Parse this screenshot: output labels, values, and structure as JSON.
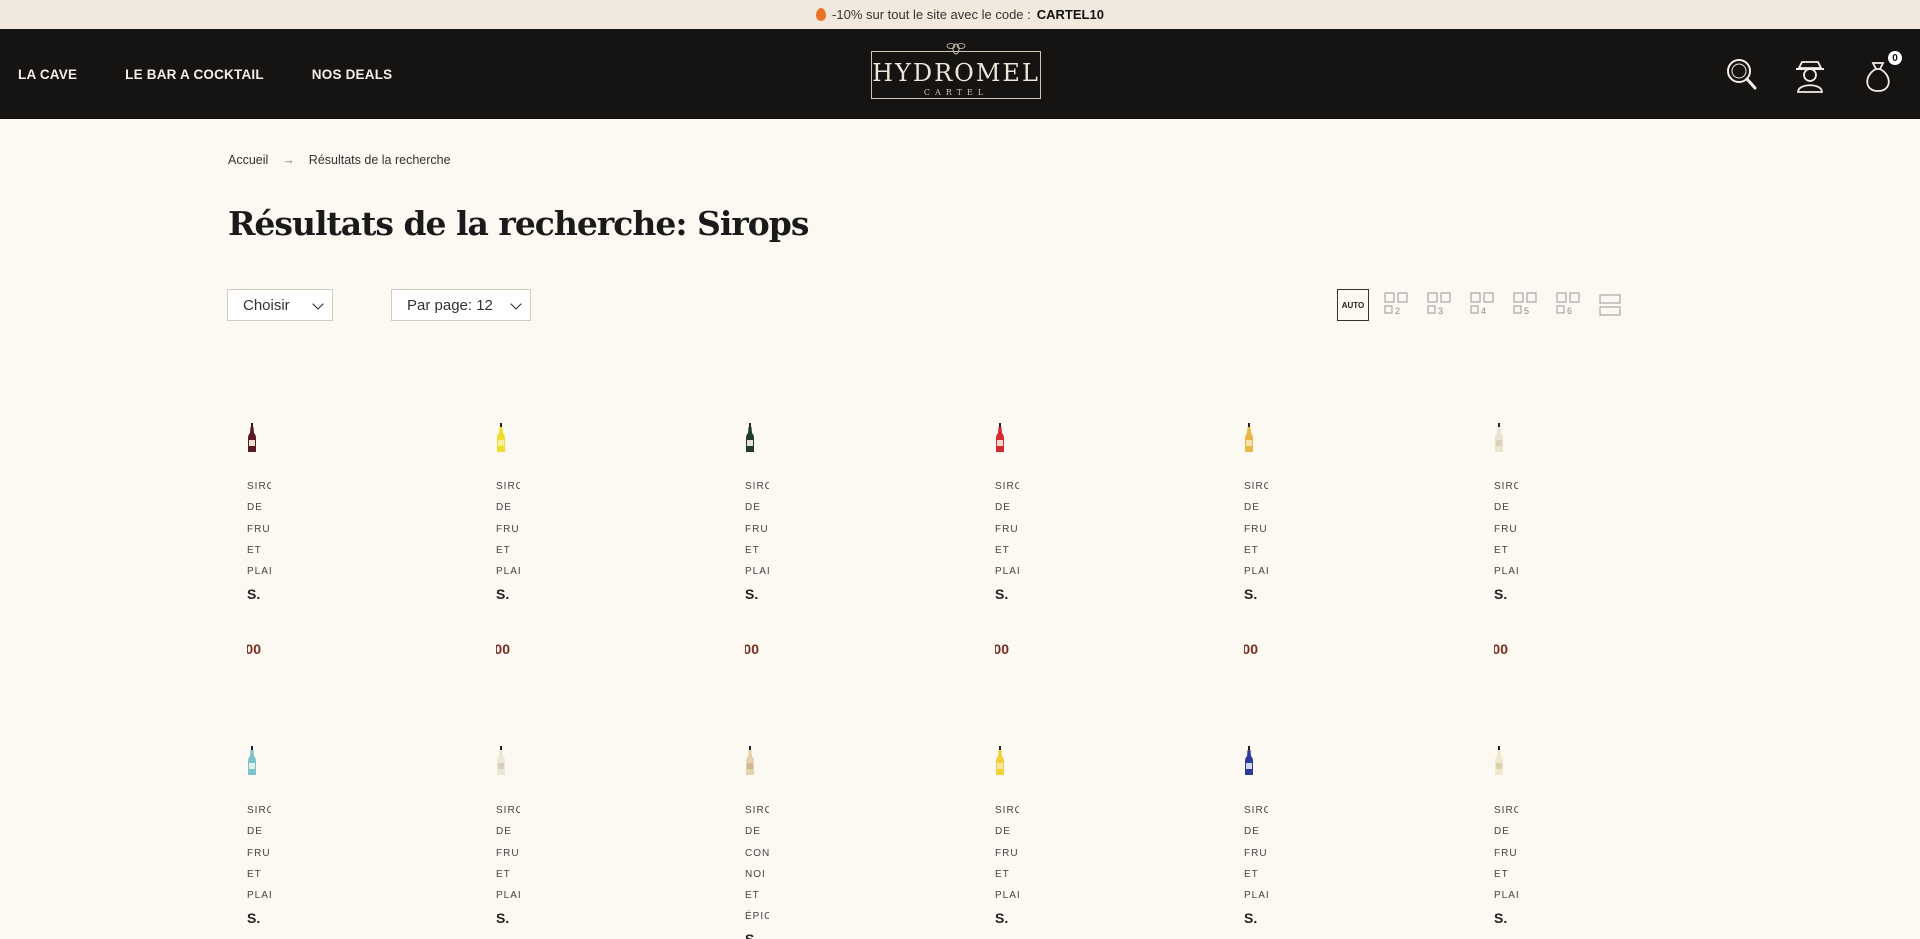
{
  "promo": {
    "text": "-10% sur tout le site avec le code : ",
    "code": "CARTEL10"
  },
  "nav": [
    {
      "label": "LA CAVE"
    },
    {
      "label": "LE BAR A COCKTAIL"
    },
    {
      "label": "NOS DEALS"
    }
  ],
  "logo": {
    "word": "HYDROMEL",
    "sub": "CARTEL"
  },
  "cart": {
    "count": "0"
  },
  "breadcrumb": {
    "home": "Accueil",
    "arrow": "→",
    "current": "Résultats de la recherche"
  },
  "page_title": "Résultats de la recherche: Sirops",
  "sort": {
    "value": "Choisir"
  },
  "per_page": {
    "value": "Par page: 12"
  },
  "grid_options": [
    "AUTO",
    "2",
    "3",
    "4",
    "5",
    "6"
  ],
  "colors": {
    "header_bg": "#151413",
    "page_bg": "#fcf8f2",
    "promo_bg": "#f1e9de",
    "price": "#7a2b1f"
  },
  "products_row1": [
    {
      "name_lines": [
        "SIRO",
        "DE",
        "FRU",
        "ET",
        "PLAI"
      ],
      "vendor": "S.",
      "price": "00",
      "bottle": "#5a1a22",
      "label": "#e8e0d4"
    },
    {
      "name_lines": [
        "SIRO",
        "DE",
        "FRU",
        "ET",
        "PLAI"
      ],
      "vendor": "S.",
      "price": "00",
      "bottle": "#f2dc2a",
      "label": "#f7ef9a"
    },
    {
      "name_lines": [
        "SIRO",
        "DE",
        "FRU",
        "ET",
        "PLAI"
      ],
      "vendor": "S.",
      "price": "00",
      "bottle": "#1f3b2c",
      "label": "#e6e1d6"
    },
    {
      "name_lines": [
        "SIRO",
        "DE",
        "FRU",
        "ET",
        "PLAI"
      ],
      "vendor": "S.",
      "price": "00",
      "bottle": "#d32a2f",
      "label": "#f1d7d0"
    },
    {
      "name_lines": [
        "SIRO",
        "DE",
        "FRU",
        "ET",
        "PLAI"
      ],
      "vendor": "S.",
      "price": "00",
      "bottle": "#e9b845",
      "label": "#f5e2b0"
    },
    {
      "name_lines": [
        "SIRO",
        "DE",
        "FRU",
        "ET",
        "PLAI"
      ],
      "vendor": "S.",
      "price": "00",
      "bottle": "#e9e3cf",
      "label": "#d9d2b8"
    }
  ],
  "products_row2": [
    {
      "name_lines": [
        "SIRO",
        "DE",
        "FRU",
        "ET",
        "PLAI"
      ],
      "vendor": "S.",
      "bottle": "#7fc3c8",
      "label": "#e0efe9"
    },
    {
      "name_lines": [
        "SIRO",
        "DE",
        "FRU",
        "ET",
        "PLAI"
      ],
      "vendor": "S.",
      "bottle": "#ece6d6",
      "label": "#d8d0bc"
    },
    {
      "name_lines": [
        "SIRO",
        "DE",
        "CON",
        "NOI",
        "ET",
        "ÉPIC"
      ],
      "vendor": "S.",
      "bottle": "#e5d3b0",
      "label": "#cdbb94"
    },
    {
      "name_lines": [
        "SIRO",
        "DE",
        "FRU",
        "ET",
        "PLAI"
      ],
      "vendor": "S.",
      "bottle": "#f0d13a",
      "label": "#f4e69a"
    },
    {
      "name_lines": [
        "SIRO",
        "DE",
        "FRU",
        "ET",
        "PLAI"
      ],
      "vendor": "S.",
      "bottle": "#2c3a9c",
      "label": "#d4d8ee"
    },
    {
      "name_lines": [
        "SIRO",
        "DE",
        "FRU",
        "ET",
        "PLAI"
      ],
      "vendor": "S.",
      "bottle": "#efe8cc",
      "label": "#ddd3a8"
    }
  ]
}
